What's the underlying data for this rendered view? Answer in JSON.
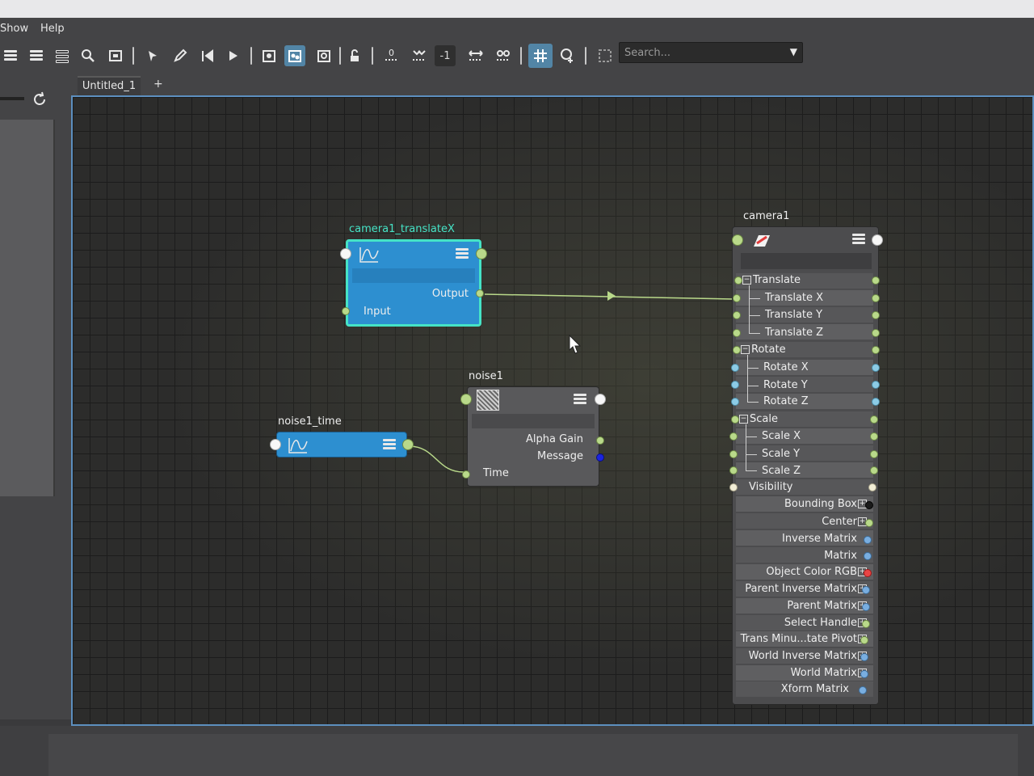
{
  "menubar": {
    "items": [
      "Show",
      "Help"
    ]
  },
  "toolbar": {
    "icons": [
      "list-view-icon",
      "list-view-icon",
      "list-view-icon",
      "search-icon",
      "frame-icon",
      "select-pin-icon",
      "edit-icon",
      "select-up-icon",
      "select-down-icon",
      "graph-icon",
      "graph-active-icon",
      "graph-add-icon",
      "lock-icon",
      "add-node-icon",
      "collapse-icon",
      "offset-value",
      "spread-icon",
      "hide-icon",
      "grid-snap-icon",
      "node-add-icon",
      "frame-box-icon"
    ],
    "offset_value": "-1",
    "search_placeholder": "Search...",
    "accent": "#5285a6"
  },
  "tabs": {
    "active": "Untitled_1",
    "add": "+"
  },
  "nodes": {
    "anim": {
      "title": "camera1_translateX",
      "output": "Output",
      "input": "Input",
      "accent": "#2d8fd0"
    },
    "noise_time": {
      "title": "noise1_time"
    },
    "noise": {
      "title": "noise1",
      "attrs": [
        "Alpha Gain",
        "Message"
      ],
      "time": "Time"
    },
    "camera": {
      "title": "camera1",
      "groups": [
        {
          "label": "Translate",
          "children": [
            "Translate X",
            "Translate Y",
            "Translate Z"
          ]
        },
        {
          "label": "Rotate",
          "children": [
            "Rotate X",
            "Rotate Y",
            "Rotate Z"
          ]
        },
        {
          "label": "Scale",
          "children": [
            "Scale X",
            "Scale Y",
            "Scale Z"
          ]
        }
      ],
      "visibility": "Visibility",
      "outputs": [
        "Bounding Box",
        "Center",
        "Inverse Matrix",
        "Matrix",
        "Object Color RGB",
        "Parent Inverse Matrix",
        "Parent Matrix",
        "Select Handle",
        "Trans Minu...tate Pivot",
        "World Inverse Matrix",
        "World Matrix",
        "Xform Matrix"
      ]
    }
  },
  "colors": {
    "selection": "#45e3c6",
    "canvas_border": "#5d8fbf",
    "connection": "#b9d98a"
  }
}
